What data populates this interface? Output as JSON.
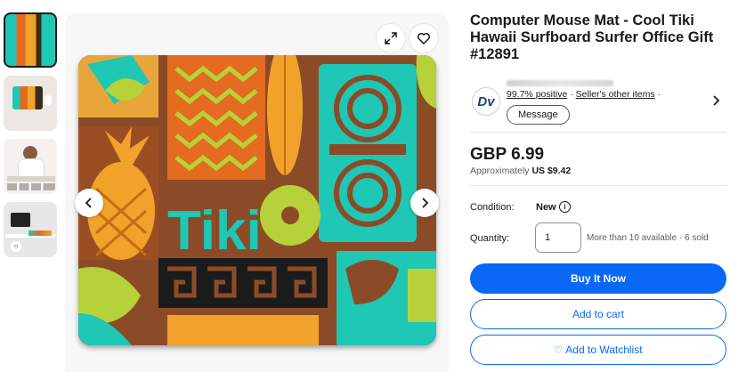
{
  "listing": {
    "title": "Computer Mouse Mat - Cool Tiki Hawaii Surfboard Surfer Office Gift #12891",
    "mat_text": "Tiki"
  },
  "seller": {
    "logo_text": "Dv",
    "feedback": "99.7% positive",
    "separator": "·",
    "other_items": "Seller's other items",
    "message_label": "Message"
  },
  "price": {
    "main": "GBP 6.99",
    "approx_label": "Approximately",
    "approx_value": "US $9.42"
  },
  "condition": {
    "label": "Condition:",
    "value": "New"
  },
  "quantity": {
    "label": "Quantity:",
    "value": "1",
    "availability": "More than 10 available · 6 sold"
  },
  "actions": {
    "buy_now": "Buy It Now",
    "add_to_cart": "Add to cart",
    "add_to_watchlist": "Add to Watchlist"
  },
  "icons": [
    "expand-icon",
    "heart-icon",
    "chevron-left-icon",
    "chevron-right-icon",
    "info-icon",
    "chevron-right-seller-icon"
  ],
  "colors": {
    "primary": "#0968f6",
    "text": "#191919"
  }
}
